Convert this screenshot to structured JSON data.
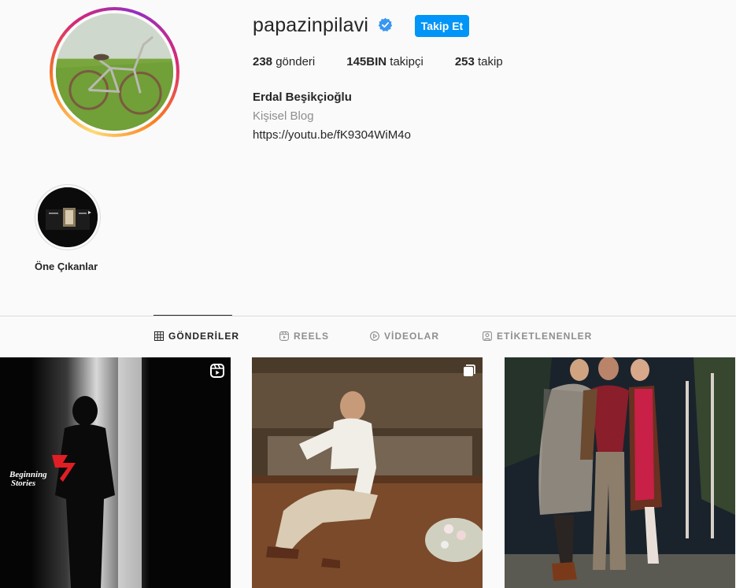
{
  "profile": {
    "username": "papazinpilavi",
    "follow_label": "Takip Et",
    "fullname": "Erdal Beşikçioğlu",
    "category": "Kişisel Blog",
    "link": "https://youtu.be/fK9304WiM4o",
    "stats": {
      "posts_count": "238",
      "posts_label": "gönderi",
      "followers_count": "145BIN",
      "followers_label": "takipçi",
      "following_count": "253",
      "following_label": "takip"
    }
  },
  "highlights": [
    {
      "label": "Öne Çıkanlar"
    }
  ],
  "tabs": [
    {
      "label": "GÖNDERİLER",
      "icon": "grid-icon",
      "active": true
    },
    {
      "label": "REELS",
      "icon": "reels-icon",
      "active": false
    },
    {
      "label": "VİDEOLAR",
      "icon": "play-icon",
      "active": false
    },
    {
      "label": "ETİKETLENENLER",
      "icon": "tagged-icon",
      "active": false
    }
  ],
  "posts": [
    {
      "type": "reel",
      "overlay_text_line1": "Beginning",
      "overlay_text_line2": "Stories"
    },
    {
      "type": "carousel"
    },
    {
      "type": "photo"
    }
  ],
  "colors": {
    "accent": "#0095f6",
    "verified": "#3897f0",
    "text": "#262626",
    "muted": "#8e8e8e",
    "background": "#fafafa"
  }
}
